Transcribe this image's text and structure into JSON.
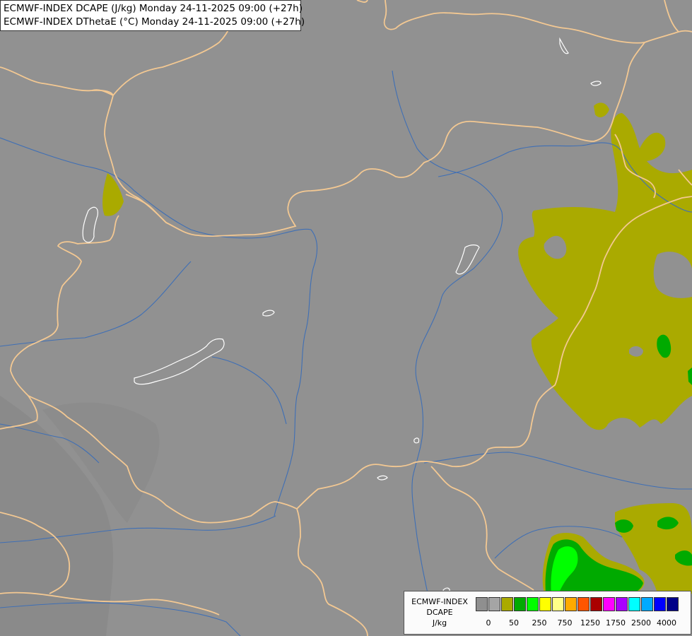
{
  "title": {
    "line1": "ECMWF-INDEX DCAPE (J/kg) Monday 24-11-2025 09:00 (+27h)",
    "line2": "ECMWF-INDEX DThetaE (°C) Monday 24-11-2025 09:00 (+27h)"
  },
  "legend": {
    "label_lines": [
      "ECMWF-INDEX",
      "DCAPE",
      "J/kg"
    ],
    "swatch_colors": [
      "#8f8f8f",
      "#a5a5a5",
      "#aaaa00",
      "#00aa00",
      "#00ff00",
      "#ffff00",
      "#ffff88",
      "#ffaa00",
      "#ff5500",
      "#aa0000",
      "#ff00ff",
      "#aa00ff",
      "#00ffff",
      "#00aaff",
      "#0000ff",
      "#000088"
    ],
    "tick_labels": [
      "0",
      "50",
      "250",
      "750",
      "1250",
      "1750",
      "2500",
      "4000"
    ]
  },
  "colors": {
    "background": "#919191",
    "border": "#f0c89a",
    "river": "#3f6fb5",
    "lake": "#ffffff",
    "dcape_50": "#aaaa00",
    "dcape_250": "#00aa00",
    "dcape_500": "#00ff00"
  }
}
